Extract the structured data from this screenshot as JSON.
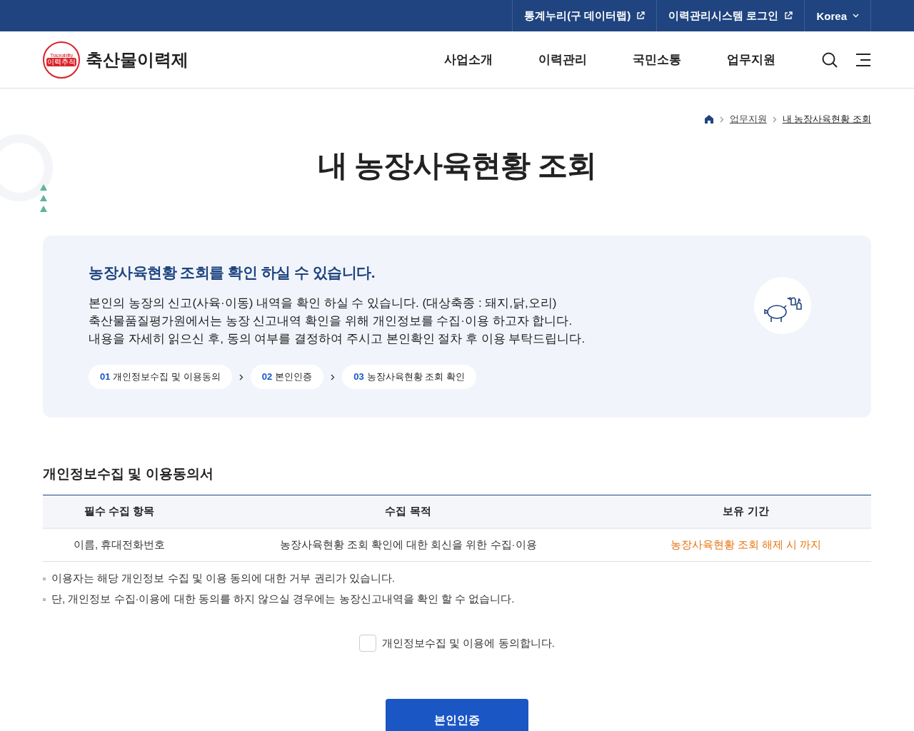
{
  "top_bar": {
    "links": [
      {
        "label": "통계누리(구 데이터랩)",
        "kind": "external"
      },
      {
        "label": "이력관리시스템 로그인",
        "kind": "external"
      },
      {
        "label": "Korea",
        "kind": "dropdown"
      }
    ]
  },
  "header": {
    "logo": {
      "badge_top": "Traceability",
      "badge_main": "이력추적",
      "name": "축산물이력제"
    },
    "nav": [
      "사업소개",
      "이력관리",
      "국민소통",
      "업무지원"
    ]
  },
  "breadcrumb": [
    "업무지원",
    "내 농장사육현황 조회"
  ],
  "page_title": "내 농장사육현황 조회",
  "intro": {
    "heading": "농장사육현황 조회를 확인 하실 수 있습니다.",
    "lines": [
      "본인의 농장의 신고(사육·이동) 내역을 확인 하실 수 있습니다. (대상축종 : 돼지,닭,오리)",
      "축산물품질평가원에서는 농장 신고내역 확인을 위해 개인정보를 수집·이용 하고자 합니다.",
      "내용을 자세히 읽으신 후, 동의 여부를 결정하여 주시고 본인확인 절차 후 이용 부탁드립니다."
    ],
    "steps": [
      {
        "number": "01",
        "label": "개인정보수집 및 이용동의"
      },
      {
        "number": "02",
        "label": "본인인증"
      },
      {
        "number": "03",
        "label": "농장사육현황 조회 확인"
      }
    ]
  },
  "consent": {
    "title": "개인정보수집 및 이용동의서",
    "table": {
      "columns": [
        "필수 수집 항목",
        "수집 목적",
        "보유 기간"
      ],
      "rows": [
        [
          "이름, 휴대전화번호",
          "농장사육현황 조회 확인에 대한 회신을 위한 수집·이용",
          "농장사육현황 조회 해제 시 까지"
        ]
      ]
    },
    "notes": [
      "이용자는 해당 개인정보 수집 및 이용 동의에 대한 거부 권리가 있습니다.",
      "단, 개인정보 수집·이용에 대한 동의를 하지 않으실 경우에는 농장신고내역을 확인 할 수 없습니다."
    ],
    "agree": {
      "label": "개인정보수집 및 이용에 동의합니다.",
      "checked": false
    },
    "button": "본인인증"
  }
}
